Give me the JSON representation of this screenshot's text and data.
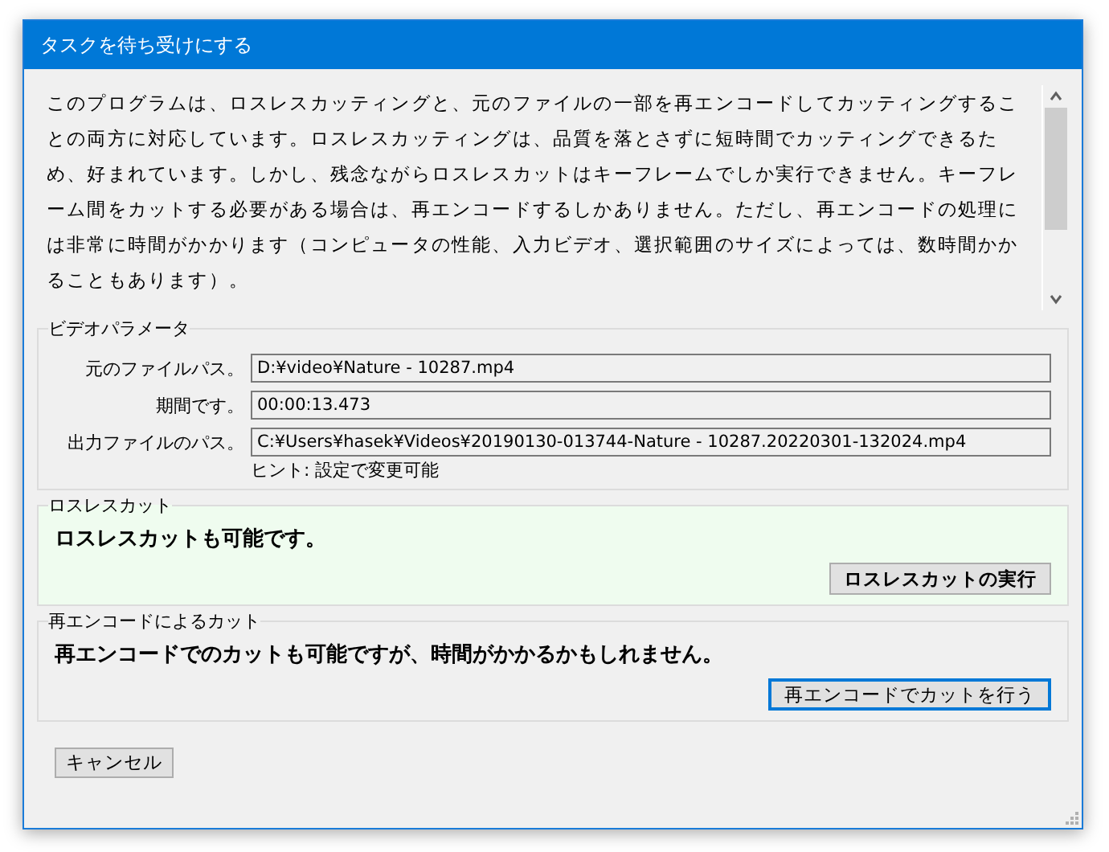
{
  "window": {
    "title": "タスクを待ち受けにする"
  },
  "description": "このプログラムは、ロスレスカッティングと、元のファイルの一部を再エンコードしてカッティングすることの両方に対応しています。ロスレスカッティングは、品質を落とさずに短時間でカッティングできるため、好まれています。しかし、残念ながらロスレスカットはキーフレームでしか実行できません。キーフレーム間をカットする必要がある場合は、再エンコードするしかありません。ただし、再エンコードの処理には非常に時間がかかります（コンピュータの性能、入力ビデオ、選択範囲のサイズによっては、数時間かかることもあります）。",
  "video_params": {
    "title": "ビデオパラメータ",
    "fields": [
      {
        "label": "元のファイルパス。",
        "value": "D:¥video¥Nature - 10287.mp4"
      },
      {
        "label": "期間です。",
        "value": "00:00:13.473"
      },
      {
        "label": "出力ファイルのパス。",
        "value": "C:¥Users¥hasek¥Videos¥20190130-013744-Nature - 10287.20220301-132024.mp4"
      }
    ],
    "hint": "ヒント: 設定で変更可能"
  },
  "cut_options": [
    {
      "title": "ロスレスカット",
      "message": "ロスレスカットも可能です。",
      "button": "ロスレスカットの実行",
      "highlighted": true,
      "focused": false
    },
    {
      "title": "再エンコードによるカット",
      "message": "再エンコードでのカットも可能ですが、時間がかかるかもしれません。",
      "button": "再エンコードでカットを行う",
      "highlighted": false,
      "focused": true
    }
  ],
  "cancel_button": "キャンセル"
}
